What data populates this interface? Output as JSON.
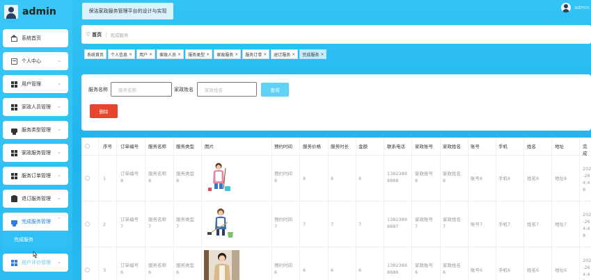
{
  "app": {
    "user_name": "admin",
    "system_title": "保洁家政服务管理平台的设计与实现",
    "top_user": "admin"
  },
  "sidebar": {
    "items": [
      {
        "label": "系统首页",
        "icon": "home-icon"
      },
      {
        "label": "个人中心",
        "icon": "id-card-icon"
      },
      {
        "label": "用户管理",
        "icon": "grid-icon"
      },
      {
        "label": "家政人员管理",
        "icon": "grid-icon"
      },
      {
        "label": "服务类型管理",
        "icon": "printer-icon"
      },
      {
        "label": "家政服务管理",
        "icon": "grid-icon"
      },
      {
        "label": "服务订单管理",
        "icon": "grid-icon"
      },
      {
        "label": "退订服务管理",
        "icon": "clipboard-icon"
      },
      {
        "label": "完成服务管理",
        "icon": "printer-icon"
      },
      {
        "label": "用户评价管理",
        "icon": "grid-icon"
      }
    ],
    "submenu": "完成服务"
  },
  "breadcrumb": {
    "home": "首页",
    "current": "完成服务"
  },
  "tags": [
    {
      "label": "系统首页",
      "closable": false
    },
    {
      "label": "个人信息",
      "closable": true
    },
    {
      "label": "用户",
      "closable": true
    },
    {
      "label": "家政人员",
      "closable": true
    },
    {
      "label": "服务类型",
      "closable": true
    },
    {
      "label": "家政服务",
      "closable": true
    },
    {
      "label": "服务订单",
      "closable": true
    },
    {
      "label": "退订服务",
      "closable": true
    },
    {
      "label": "完成服务",
      "closable": true
    }
  ],
  "search": {
    "service_name_label": "服务名称",
    "service_name_placeholder": "服务名称",
    "staff_name_label": "家政姓名",
    "staff_name_placeholder": "家政姓名",
    "query_button": "查询",
    "delete_button": "删除"
  },
  "table": {
    "headers": [
      "序号",
      "订单编号",
      "服务名称",
      "服务类型",
      "图片",
      "预约时间",
      "服务价格",
      "服务时长",
      "金额",
      "联系电话",
      "家政账号",
      "家政姓名",
      "账号",
      "手机",
      "姓名",
      "地址",
      "完成"
    ],
    "rows": [
      {
        "index": "1",
        "order_no": "订单编号8",
        "service_name": "服务名称8",
        "service_type": "服务类型8",
        "image": "cleaning-worker-figure",
        "time": "预约时间8",
        "price": "8",
        "duration": "8",
        "amount": "8",
        "phone": "13823888888",
        "staff_account": "家政账号8",
        "staff_name": "家政姓名8",
        "account": "账号8",
        "mobile": "手机8",
        "name": "姓名8",
        "address": "地址8",
        "finish": "202-26 4:48"
      },
      {
        "index": "2",
        "order_no": "订单编号7",
        "service_name": "服务名称7",
        "service_type": "服务类型7",
        "image": "cleaning-worker-figure",
        "time": "预约时间7",
        "price": "7",
        "duration": "7",
        "amount": "7",
        "phone": "13823888887",
        "staff_account": "家政账号7",
        "staff_name": "家政姓名7",
        "account": "账号7",
        "mobile": "手机7",
        "name": "姓名7",
        "address": "地址7",
        "finish": "202-26 4:48"
      },
      {
        "index": "3",
        "order_no": "订单编号6",
        "service_name": "服务名称6",
        "service_type": "服务类型6",
        "image": "housekeeper-photo",
        "time": "预约时间6",
        "price": "6",
        "duration": "6",
        "amount": "6",
        "phone": "13823888886",
        "staff_account": "家政账号6",
        "staff_name": "家政姓名6",
        "account": "账号6",
        "mobile": "手机6",
        "name": "姓名6",
        "address": "地址6",
        "finish": "202-26 4:48"
      }
    ]
  },
  "colors": {
    "accent": "#1fb4ec",
    "delete": "#e8452f",
    "query": "#5fd3f6"
  }
}
